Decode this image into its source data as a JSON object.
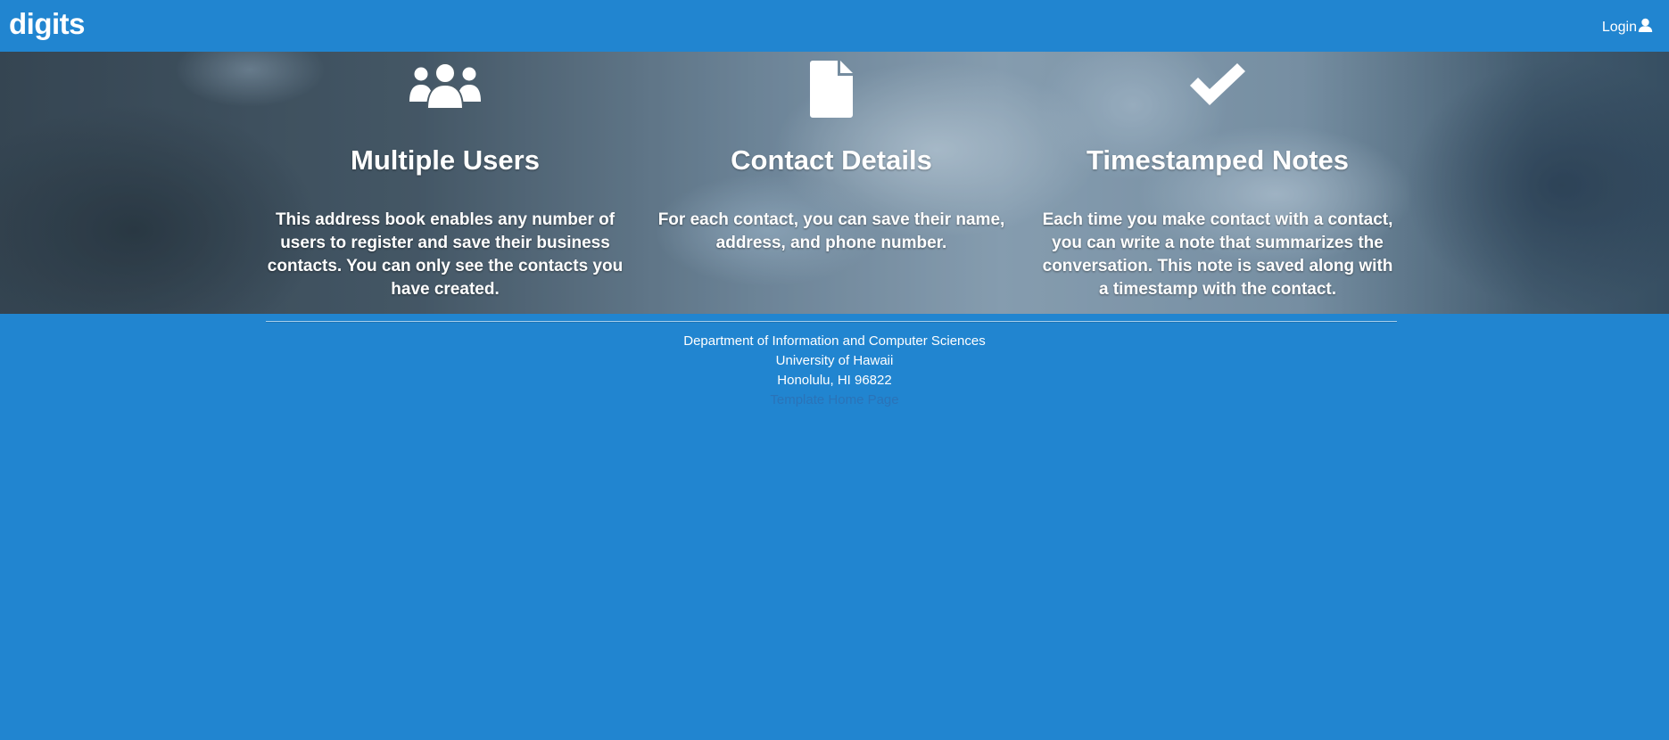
{
  "navbar": {
    "brand": "digits",
    "login_label": "Login",
    "login_icon": "user-icon"
  },
  "features": [
    {
      "icon": "users-icon",
      "title": "Multiple Users",
      "description": "This address book enables any number of users to register and save their business contacts. You can only see the contacts you have created."
    },
    {
      "icon": "file-icon",
      "title": "Contact Details",
      "description": "For each contact, you can save their name, address, and phone number."
    },
    {
      "icon": "checkmark-icon",
      "title": "Timestamped Notes",
      "description": "Each time you make contact with a contact, you can write a note that summarizes the conversation. This note is saved along with a timestamp with the contact."
    }
  ],
  "footer": {
    "line1": "Department of Information and Computer Sciences",
    "line2": "University of Hawaii",
    "line3": "Honolulu, HI 96822",
    "link_label": "Template Home Page"
  },
  "colors": {
    "primary": "#2185d0",
    "text": "#ffffff",
    "link": "#2a73b8"
  }
}
